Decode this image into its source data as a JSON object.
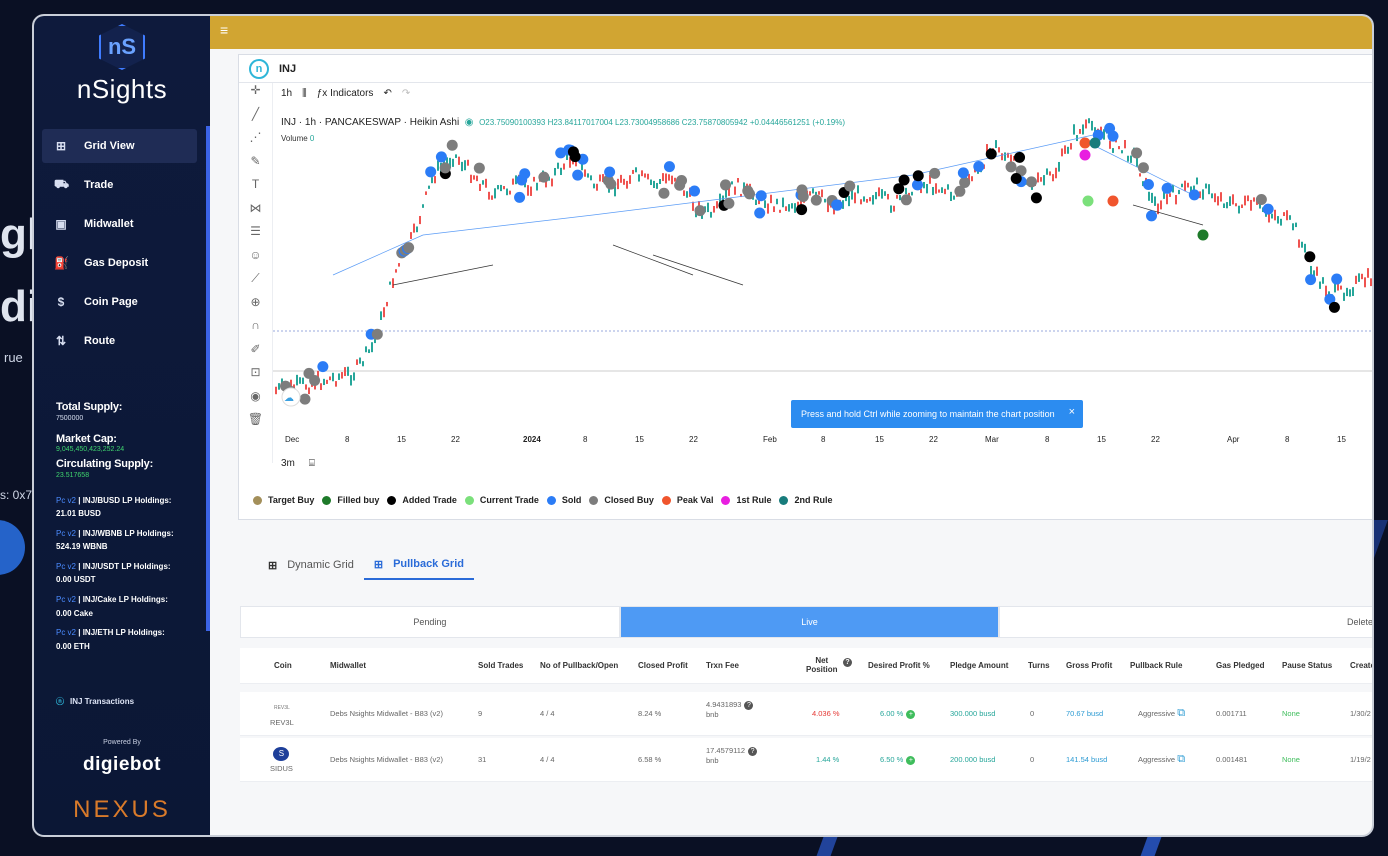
{
  "colors": {
    "sidebar": "#0e1a3c",
    "topbar": "#d1a532",
    "accent": "#2a6bd8",
    "live_tab": "#4e9af4"
  },
  "background_fragments": {
    "text1": "gh",
    "text2": "di",
    "text3": "rue",
    "text4": "s: 0x7"
  },
  "sidebar": {
    "brand": "nSights",
    "brand_mark": "nS",
    "nav": [
      {
        "label": "Grid View",
        "icon": "grid-icon",
        "active": true
      },
      {
        "label": "Trade",
        "icon": "cart-icon",
        "active": false
      },
      {
        "label": "Midwallet",
        "icon": "wallet-icon",
        "active": false
      },
      {
        "label": "Gas Deposit",
        "icon": "fuel-icon",
        "active": false
      },
      {
        "label": "Coin Page",
        "icon": "coin-icon",
        "active": false
      },
      {
        "label": "Route",
        "icon": "route-icon",
        "active": false
      }
    ],
    "total_supply_label": "Total Supply:",
    "total_supply": "7500000",
    "market_cap_label": "Market Cap:",
    "market_cap": "9,045,450,423,252.24",
    "circ_label": "Circulating Supply:",
    "circ": "23.517658",
    "holdings": [
      {
        "pc": "Pc v2",
        "pair": " | INJ/BUSD LP Holdings:",
        "value": "21.01 BUSD"
      },
      {
        "pc": "Pc v2",
        "pair": " | INJ/WBNB LP Holdings:",
        "value": "524.19 WBNB"
      },
      {
        "pc": "Pc v2",
        "pair": " | INJ/USDT LP Holdings:",
        "value": "0.00 USDT"
      },
      {
        "pc": "Pc v2",
        "pair": " | INJ/Cake LP Holdings:",
        "value": "0.00 Cake"
      },
      {
        "pc": "Pc v2",
        "pair": " | INJ/ETH LP Holdings:",
        "value": "0.00 ETH"
      }
    ],
    "transactions": "INJ Transactions",
    "powered_by": "Powered By",
    "digiebot": "digiebot",
    "nexus": "NEXUS"
  },
  "chart_header": {
    "symbol": "INJ"
  },
  "toolbar": {
    "interval": "1h",
    "indicators": "Indicators"
  },
  "ohlc": {
    "title": "INJ · 1h · PANCAKESWAP · Heikin Ashi",
    "values": "O23.75090100393 H23.84117017004 L23.73004958686 C23.75870805942 +0.04446561251 (+0.19%)",
    "volume_label": "Volume",
    "volume": "0"
  },
  "toast": {
    "text": "Press and hold Ctrl while zooming to maintain the chart position",
    "close": "×"
  },
  "xaxis": [
    "Dec",
    "8",
    "15",
    "22",
    "2024",
    "8",
    "15",
    "22",
    "Feb",
    "8",
    "15",
    "22",
    "Mar",
    "8",
    "15",
    "22",
    "Apr",
    "8",
    "15"
  ],
  "timeframe": {
    "value": "3m"
  },
  "legend": [
    {
      "label": "Target Buy",
      "color": "#a38f5a"
    },
    {
      "label": "Filled buy",
      "color": "#1e7a2a"
    },
    {
      "label": "Added Trade",
      "color": "#000000"
    },
    {
      "label": "Current Trade",
      "color": "#7be07b"
    },
    {
      "label": "Sold",
      "color": "#2b7cf6"
    },
    {
      "label": "Closed Buy",
      "color": "#7d7d7d"
    },
    {
      "label": "Peak Val",
      "color": "#f0552d"
    },
    {
      "label": "1st Rule",
      "color": "#e81ee0"
    },
    {
      "label": "2nd Rule",
      "color": "#187c7c"
    }
  ],
  "grid_tabs": [
    {
      "label": "Dynamic Grid",
      "active": false
    },
    {
      "label": "Pullback Grid",
      "active": true
    }
  ],
  "status_tabs": [
    {
      "label": "Pending",
      "active": false
    },
    {
      "label": "Live",
      "active": true
    },
    {
      "label": "Delete",
      "active": false
    }
  ],
  "table": {
    "headers": [
      "Coin",
      "Midwallet",
      "Sold Trades",
      "No of Pullback/Open",
      "Closed Profit",
      "Trxn Fee",
      "Net\nPosition",
      "Desired Profit %",
      "Pledge Amount",
      "Turns",
      "Gross Profit",
      "Pullback Rule",
      "Gas Pledged",
      "Pause Status",
      "Create"
    ],
    "rows": [
      {
        "coin": "REV3L",
        "logo": "REV3L",
        "midwallet": "Debs Nsights Midwallet - B83 (v2)",
        "sold": "9",
        "pullback": "4 / 4",
        "closed": "8.24 %",
        "fee": "4.9431893",
        "fee_unit": "bnb",
        "net": "4.036 %",
        "net_color": "red",
        "desired": "6.00 %",
        "pledge": "300.000 busd",
        "turns": "0",
        "gross": "70.67 busd",
        "rule": "Aggressive",
        "gas": "0.001711",
        "pause": "None",
        "created": "1/30/2"
      },
      {
        "coin": "SIDUS",
        "logo": "S",
        "midwallet": "Debs Nsights Midwallet - B83 (v2)",
        "sold": "31",
        "pullback": "4 / 4",
        "closed": "6.58 %",
        "fee": "17.4579112",
        "fee_unit": "bnb",
        "net": "1.44 %",
        "net_color": "teal",
        "desired": "6.50 %",
        "pledge": "200.000 busd",
        "turns": "0",
        "gross": "141.54 busd",
        "rule": "Aggressive",
        "gas": "0.001481",
        "pause": "None",
        "created": "1/19/2"
      }
    ]
  }
}
